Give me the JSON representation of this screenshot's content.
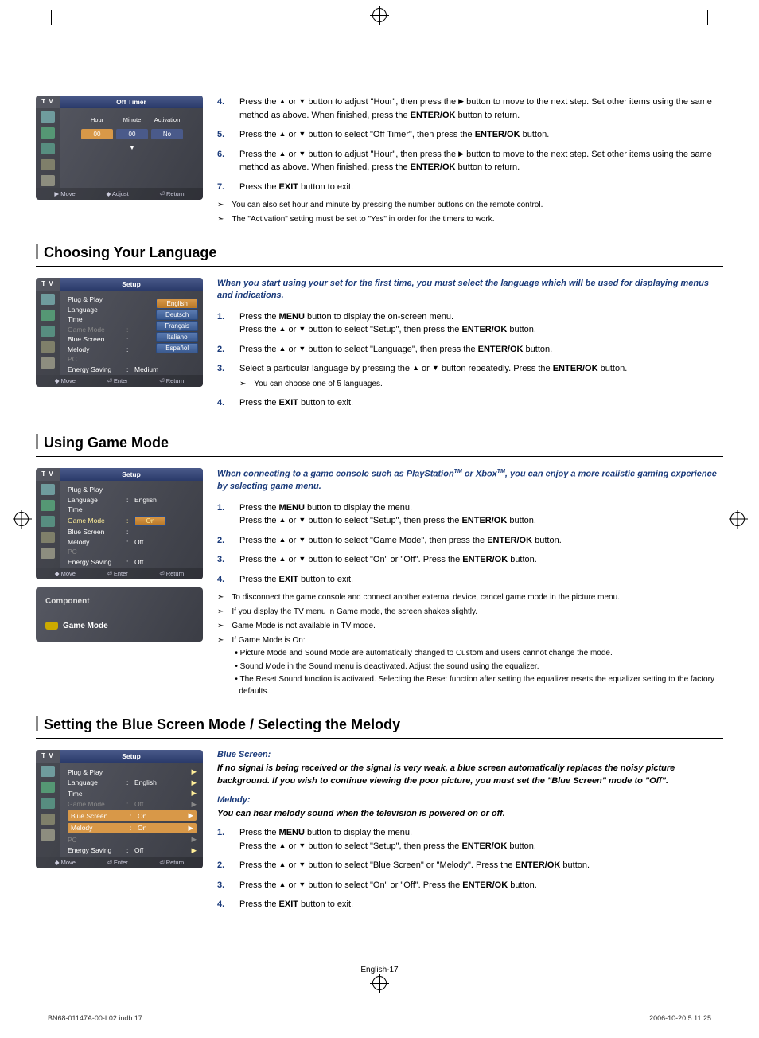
{
  "osd_timer": {
    "tv": "T V",
    "title": "Off Timer",
    "cols": [
      "Hour",
      "Minute",
      "Activation"
    ],
    "vals": [
      "00",
      "00",
      "No"
    ],
    "foot": [
      "▶ Move",
      "◆ Adjust",
      "⏎ Return"
    ]
  },
  "step4": {
    "n": "4.",
    "t1": "Press the ",
    "t2": " or ",
    "t3": " button to adjust \"Hour\", then press the ",
    "t4": " button to move to the next step. Set other items using the same method as above. When finished, press the ",
    "t5": " button to return.",
    "enter": "ENTER/OK"
  },
  "step5": {
    "n": "5.",
    "t1": "Press the ",
    "t2": " or ",
    "t3": " button to select \"Off Timer\", then press the ",
    "t4": " button.",
    "enter": "ENTER/OK"
  },
  "step6": {
    "n": "6.",
    "t1": "Press the ",
    "t2": " or ",
    "t3": " button to adjust \"Hour\", then press the ",
    "t4": " button to move to the next step. Set other items using the same method as above. When finished, press the ",
    "t5": " button to return.",
    "enter": "ENTER/OK"
  },
  "step7": {
    "n": "7.",
    "t1": "Press the ",
    "exit": "EXIT",
    "t2": " button to exit."
  },
  "note7a": "You can also set hour and minute by pressing the number buttons on the remote control.",
  "note7b": "The \"Activation\" setting must be set to \"Yes\" in order for the timers to work.",
  "sect1": "Choosing Your Language",
  "osd_lang": {
    "tv": "T V",
    "title": "Setup",
    "rows": [
      {
        "l": "Plug & Play",
        "v": "",
        "dim": false
      },
      {
        "l": "Language",
        "v": "",
        "dim": false,
        "langs": true
      },
      {
        "l": "Time",
        "v": "",
        "dim": false
      },
      {
        "l": "Game Mode",
        "v": "",
        "dim": true
      },
      {
        "l": "Blue Screen",
        "v": "",
        "dim": false
      },
      {
        "l": "Melody",
        "v": "",
        "dim": false
      },
      {
        "l": "PC",
        "v": "",
        "dim": true
      },
      {
        "l": "Energy Saving",
        "v": "Medium",
        "dim": false,
        "sep": ":"
      }
    ],
    "langs": [
      "English",
      "Deutsch",
      "Français",
      "Italiano",
      "Español"
    ],
    "foot": [
      "◆ Move",
      "⏎ Enter",
      "⏎ Return"
    ]
  },
  "lang_intro": "When you start using your set for the first time, you must select the language which will be used for displaying menus and indications.",
  "ls1": {
    "n": "1.",
    "a": "Press the ",
    "menu": "MENU",
    "b": " button to display the on-screen menu.",
    "c": "Press the ",
    "d": " or ",
    "e": " button to select \"Setup\", then press the ",
    "enter": "ENTER/OK",
    "f": " button."
  },
  "ls2": {
    "n": "2.",
    "a": "Press the ",
    "b": " or ",
    "c": " button to select \"Language\", then press the ",
    "enter": "ENTER/OK",
    "d": " button."
  },
  "ls3": {
    "n": "3.",
    "a": "Select a particular language by pressing the ",
    "b": " or ",
    "c": " button repeatedly. Press the ",
    "enter": "ENTER/OK",
    "d": " button.",
    "note": "You can choose one of 5 languages."
  },
  "ls4": {
    "n": "4.",
    "a": "Press the ",
    "exit": "EXIT",
    "b": " button to exit."
  },
  "sect2": "Using Game Mode",
  "osd_game": {
    "tv": "T V",
    "title": "Setup",
    "rows": [
      {
        "l": "Plug & Play",
        "v": ""
      },
      {
        "l": "Language",
        "v": "English",
        "sep": ":"
      },
      {
        "l": "Time",
        "v": ""
      },
      {
        "l": "Game Mode",
        "v": "",
        "sel": true
      },
      {
        "l": "Blue Screen",
        "v": "",
        "sep": ":"
      },
      {
        "l": "Melody",
        "v": "Off",
        "sep": ":"
      },
      {
        "l": "PC",
        "v": "",
        "dim": true
      },
      {
        "l": "Energy Saving",
        "v": "Off",
        "sep": ":"
      }
    ],
    "selpill": "On",
    "foot": [
      "◆ Move",
      "⏎ Enter",
      "⏎ Return"
    ]
  },
  "game_panel": {
    "comp": "Component",
    "gm": "Game Mode"
  },
  "game_intro_a": "When connecting to a game console such as PlayStation",
  "tm": "TM",
  "game_intro_b": " or Xbox",
  "game_intro_c": ", you can enjoy a more realistic gaming experience by selecting game menu.",
  "gs1": {
    "n": "1.",
    "a": "Press the ",
    "menu": "MENU",
    "b": " button to display the menu.",
    "c": "Press the ",
    "d": " or ",
    "e": " button to select \"Setup\", then press the ",
    "enter": "ENTER/OK",
    "f": " button."
  },
  "gs2": {
    "n": "2.",
    "a": "Press the ",
    "b": " or ",
    "c": " button to select \"Game Mode\", then press the ",
    "enter": "ENTER/OK",
    "d": " button."
  },
  "gs3": {
    "n": "3.",
    "a": "Press the ",
    "b": " or ",
    "c": " button to select \"On\" or \"Off\". Press the ",
    "enter": "ENTER/OK",
    "d": " button."
  },
  "gs4": {
    "n": "4.",
    "a": "Press the ",
    "exit": "EXIT",
    "b": " button to exit."
  },
  "gnote1": "To disconnect the game console and connect another external device, cancel game mode in the picture menu.",
  "gnote2": "If you display the TV menu in Game mode, the screen shakes slightly.",
  "gnote3": "Game Mode is not available in TV mode.",
  "gnote4": "If Game Mode is On:",
  "gnote4a": "• Picture Mode and Sound Mode are automatically changed to Custom and users cannot change the mode.",
  "gnote4b": "• Sound Mode in the Sound menu is deactivated. Adjust the sound using the equalizer.",
  "gnote4c": "• The Reset Sound function is activated. Selecting the Reset function after setting the equalizer resets the equalizer setting to the factory defaults.",
  "sect3": "Setting the Blue Screen Mode / Selecting the Melody",
  "osd_blue": {
    "tv": "T V",
    "title": "Setup",
    "rows": [
      {
        "l": "Plug & Play",
        "v": ""
      },
      {
        "l": "Language",
        "v": "English",
        "sep": ":"
      },
      {
        "l": "Time",
        "v": ""
      },
      {
        "l": "Game Mode",
        "v": "Off",
        "sep": ":",
        "dim": true
      },
      {
        "l": "Blue Screen",
        "v": "On",
        "sep": ":",
        "hl": true
      },
      {
        "l": "Melody",
        "v": "On",
        "sep": ":",
        "hl": true
      },
      {
        "l": "PC",
        "v": "",
        "dim": true
      },
      {
        "l": "Energy Saving",
        "v": "Off",
        "sep": ":"
      }
    ],
    "foot": [
      "◆ Move",
      "⏎ Enter",
      "⏎ Return"
    ]
  },
  "blue_h": "Blue Screen:",
  "blue_intro": "If no signal is being received or the signal is very weak, a blue screen automatically replaces the noisy picture background. If you wish to continue viewing the poor picture, you must set the \"Blue Screen\" mode to \"Off\".",
  "mel_h": "Melody:",
  "mel_intro": "You can hear melody sound when the television is powered on or off.",
  "bs1": {
    "n": "1.",
    "a": "Press the ",
    "menu": "MENU",
    "b": " button to display the menu.",
    "c": "Press the ",
    "d": " or ",
    "e": " button to select \"Setup\", then press the ",
    "enter": "ENTER/OK",
    "f": " button."
  },
  "bs2": {
    "n": "2.",
    "a": "Press the ",
    "b": " or ",
    "c": " button to select \"Blue Screen\" or \"Melody\". Press the ",
    "enter": "ENTER/OK",
    "d": " button."
  },
  "bs3": {
    "n": "3.",
    "a": "Press the ",
    "b": " or ",
    "c": " button to select \"On\" or \"Off\". Press the ",
    "enter": "ENTER/OK",
    "d": " button."
  },
  "bs4": {
    "n": "4.",
    "a": "Press the ",
    "exit": "EXIT",
    "b": " button to exit."
  },
  "page_num": "English-17",
  "doc_file": "BN68-01147A-00-L02.indb   17",
  "doc_time": "2006-10-20   5:11:25"
}
